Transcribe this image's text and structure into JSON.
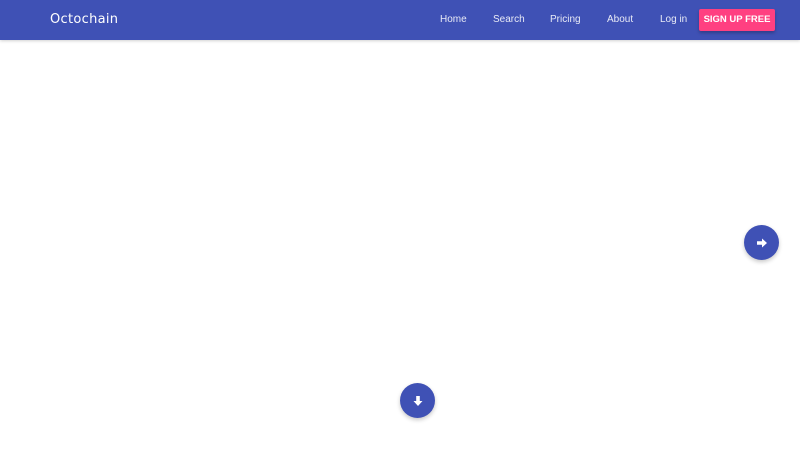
{
  "navbar": {
    "brand": "Octochain",
    "links": [
      "Home",
      "Search",
      "Pricing",
      "About",
      "Log in"
    ],
    "signup_label": "SIGN UP FREE",
    "colors": {
      "primary": "#3f51b5",
      "accent": "#ff4081"
    }
  },
  "fabs": {
    "next_icon": "arrow-right-icon",
    "scroll_icon": "arrow-down-icon"
  }
}
